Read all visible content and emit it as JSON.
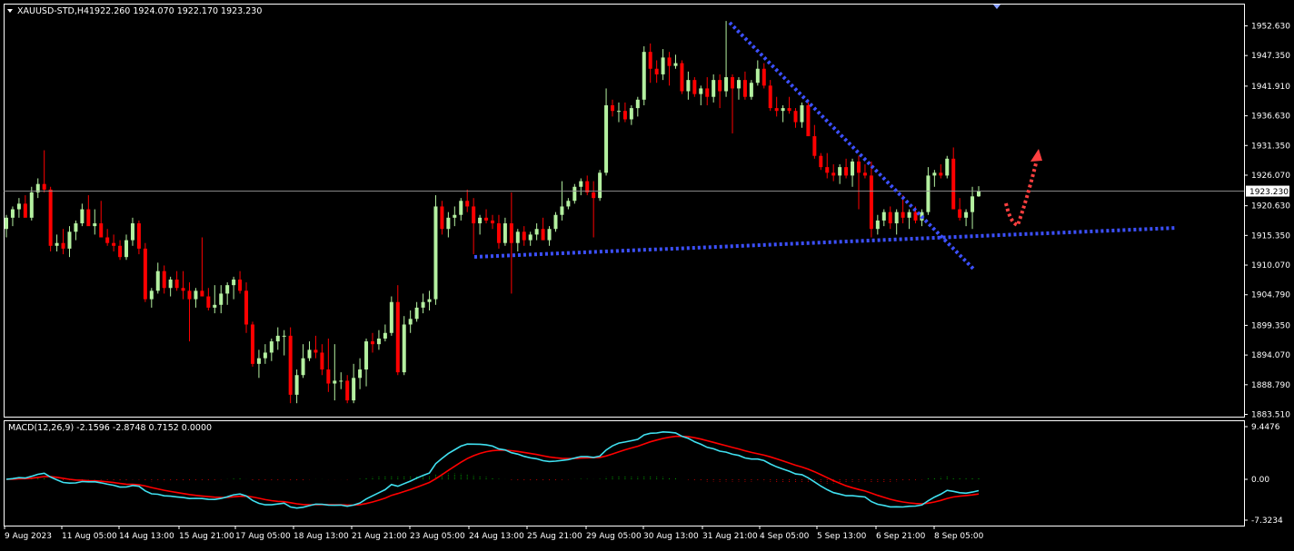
{
  "header": {
    "symbol": "XAUUSD-STD,H4",
    "ohlc": "1922.260 1924.070 1922.170 1923.230"
  },
  "macd_header": "MACD(12,26,9) -2.1596 -2.8748 0.7152 0.0000",
  "price_label": "1923.230",
  "colors": {
    "background": "#000000",
    "bull": "#b4f0a0",
    "bear": "#ff0000",
    "macd_line": "#40e0f0",
    "signal_line": "#ff0000",
    "trendline": "#3c50ff",
    "arrow": "#ff4040",
    "border": "#ffffff",
    "histogram_positive": "#00a000",
    "histogram_negative": "#c00000"
  },
  "chart_data": [
    {
      "type": "candlestick",
      "title": "XAUUSD-STD,H4",
      "y_ticks": [
        "1952.630",
        "1947.350",
        "1941.910",
        "1936.630",
        "1931.350",
        "1926.070",
        "1920.630",
        "1915.350",
        "1910.070",
        "1904.790",
        "1899.350",
        "1894.070",
        "1888.790",
        "1883.510"
      ],
      "ylim": [
        1883.51,
        1955.0
      ],
      "x_ticks": [
        "9 Aug 2023",
        "11 Aug 05:00",
        "14 Aug 13:00",
        "15 Aug 21:00",
        "17 Aug 05:00",
        "18 Aug 13:00",
        "21 Aug 21:00",
        "23 Aug 05:00",
        "24 Aug 13:00",
        "25 Aug 21:00",
        "29 Aug 05:00",
        "30 Aug 13:00",
        "31 Aug 21:00",
        "4 Sep 05:00",
        "5 Sep 13:00",
        "6 Sep 21:00",
        "8 Sep 05:00"
      ],
      "current_price": 1923.23,
      "candles_ohlc": [
        [
          1916.5,
          1919,
          1915,
          1918.5
        ],
        [
          1918.5,
          1920.5,
          1917,
          1920
        ],
        [
          1920,
          1922,
          1918.5,
          1921
        ],
        [
          1921,
          1922.5,
          1919,
          1918.5
        ],
        [
          1918.5,
          1924,
          1918,
          1923
        ],
        [
          1923,
          1925.5,
          1922,
          1924.5
        ],
        [
          1924.5,
          1930.5,
          1923,
          1923.5
        ],
        [
          1923.5,
          1924,
          1912.5,
          1913.5
        ],
        [
          1913.5,
          1915.5,
          1912.5,
          1914
        ],
        [
          1914,
          1916.5,
          1912,
          1913
        ],
        [
          1913,
          1917,
          1911.5,
          1916
        ],
        [
          1916,
          1918,
          1914.5,
          1917.5
        ],
        [
          1917.5,
          1921,
          1917,
          1920
        ],
        [
          1920,
          1922.5,
          1918,
          1917
        ],
        [
          1917,
          1920,
          1915.5,
          1917.5
        ],
        [
          1917.5,
          1921.5,
          1916.5,
          1915
        ],
        [
          1915,
          1916.5,
          1913.5,
          1914
        ],
        [
          1914,
          1915.5,
          1912.5,
          1913.5
        ],
        [
          1913.5,
          1914.5,
          1911,
          1911.5
        ],
        [
          1911.5,
          1915.5,
          1911,
          1914.5
        ],
        [
          1914.5,
          1918.5,
          1913.5,
          1917.5
        ],
        [
          1917.5,
          1918,
          1912,
          1913
        ],
        [
          1913,
          1914,
          1903.5,
          1904
        ],
        [
          1904,
          1906,
          1902.5,
          1905.5
        ],
        [
          1905.5,
          1910.5,
          1905,
          1909
        ],
        [
          1909,
          1910,
          1905,
          1906
        ],
        [
          1906,
          1908,
          1904.5,
          1907.5
        ],
        [
          1907.5,
          1909,
          1905.5,
          1906
        ],
        [
          1906,
          1909,
          1904,
          1905.5
        ],
        [
          1905.5,
          1907,
          1896.5,
          1904
        ],
        [
          1904,
          1906,
          1902.5,
          1905.5
        ],
        [
          1905.5,
          1915,
          1904.5,
          1904.5
        ],
        [
          1904.5,
          1906,
          1902,
          1902.5
        ],
        [
          1902.5,
          1906.5,
          1901.5,
          1903
        ],
        [
          1903,
          1906.5,
          1901.5,
          1905
        ],
        [
          1905,
          1907,
          1903,
          1906.5
        ],
        [
          1906.5,
          1908,
          1904,
          1907.5
        ],
        [
          1907.5,
          1909,
          1905,
          1905.5
        ],
        [
          1905.5,
          1907,
          1898,
          1899.5
        ],
        [
          1899.5,
          1900,
          1892,
          1892.5
        ],
        [
          1892.5,
          1895,
          1890,
          1893.5
        ],
        [
          1893.5,
          1896,
          1892.5,
          1894.5
        ],
        [
          1894.5,
          1897,
          1893,
          1896.5
        ],
        [
          1896.5,
          1899,
          1895,
          1897.5
        ],
        [
          1897.5,
          1898.5,
          1894,
          1897.5
        ],
        [
          1897.5,
          1899,
          1885.5,
          1887
        ],
        [
          1887,
          1891.5,
          1885.5,
          1890.5
        ],
        [
          1890.5,
          1896,
          1890,
          1893.5
        ],
        [
          1893.5,
          1896.5,
          1893,
          1895
        ],
        [
          1895,
          1897.5,
          1893.5,
          1894.5
        ],
        [
          1894.5,
          1896,
          1890.5,
          1891.5
        ],
        [
          1891.5,
          1897,
          1887.5,
          1889
        ],
        [
          1889,
          1896,
          1886,
          1889.5
        ],
        [
          1889.5,
          1891,
          1888,
          1889.5
        ],
        [
          1889.5,
          1890.5,
          1885.5,
          1886
        ],
        [
          1886,
          1892.5,
          1885.5,
          1890
        ],
        [
          1890,
          1893.5,
          1888,
          1891.5
        ],
        [
          1891.5,
          1897,
          1888.5,
          1896.5
        ],
        [
          1896.5,
          1898,
          1894.5,
          1896
        ],
        [
          1896,
          1898.5,
          1895,
          1897
        ],
        [
          1897,
          1899.5,
          1896.5,
          1898
        ],
        [
          1898,
          1904.5,
          1897.5,
          1903.5
        ],
        [
          1903.5,
          1906.5,
          1890.5,
          1891
        ],
        [
          1891,
          1901,
          1890.5,
          1899.5
        ],
        [
          1899.5,
          1902,
          1898,
          1900.5
        ],
        [
          1900.5,
          1903.5,
          1900,
          1902.5
        ],
        [
          1902.5,
          1905,
          1901.5,
          1903.5
        ],
        [
          1903.5,
          1905.5,
          1902,
          1904
        ],
        [
          1904,
          1922.5,
          1903,
          1920.5
        ],
        [
          1920.5,
          1921.5,
          1915.5,
          1916.5
        ],
        [
          1916.5,
          1919.5,
          1915,
          1918.5
        ],
        [
          1918.5,
          1920.5,
          1917,
          1919
        ],
        [
          1919,
          1922,
          1918,
          1921.5
        ],
        [
          1921.5,
          1923.5,
          1919.5,
          1920.5
        ],
        [
          1920.5,
          1922,
          1912,
          1917.5
        ],
        [
          1917.5,
          1919,
          1915.5,
          1918.5
        ],
        [
          1918.5,
          1920,
          1917.5,
          1918
        ],
        [
          1918,
          1919,
          1916.5,
          1917.5
        ],
        [
          1917.5,
          1919,
          1913,
          1914
        ],
        [
          1914,
          1918.5,
          1913.5,
          1917.5
        ],
        [
          1917.5,
          1923,
          1905,
          1914
        ],
        [
          1914,
          1916.5,
          1912.5,
          1916
        ],
        [
          1916,
          1917,
          1913.5,
          1914.5
        ],
        [
          1914.5,
          1916,
          1913.5,
          1915.5
        ],
        [
          1915.5,
          1917.5,
          1914.5,
          1916.5
        ],
        [
          1916.5,
          1918.5,
          1915.5,
          1914.5
        ],
        [
          1914.5,
          1917,
          1913.5,
          1916.5
        ],
        [
          1916.5,
          1919.5,
          1916,
          1919
        ],
        [
          1919,
          1925,
          1918,
          1920.5
        ],
        [
          1920.5,
          1922,
          1920,
          1921.5
        ],
        [
          1921.5,
          1924.5,
          1921,
          1924
        ],
        [
          1924,
          1925.5,
          1922.5,
          1925
        ],
        [
          1925,
          1926,
          1922.5,
          1923
        ],
        [
          1923,
          1925,
          1915,
          1922
        ],
        [
          1922,
          1927,
          1921.5,
          1926.5
        ],
        [
          1926.5,
          1941.5,
          1926,
          1938.5
        ],
        [
          1938.5,
          1939.5,
          1936.5,
          1937.5
        ],
        [
          1937.5,
          1939,
          1935.5,
          1937.5
        ],
        [
          1937.5,
          1939,
          1935.5,
          1936
        ],
        [
          1936,
          1938.5,
          1935,
          1938
        ],
        [
          1938,
          1940,
          1936.5,
          1939.5
        ],
        [
          1939.5,
          1949,
          1938.5,
          1948
        ],
        [
          1948,
          1949.5,
          1942.5,
          1945
        ],
        [
          1945,
          1946.5,
          1942.5,
          1944
        ],
        [
          1944,
          1948.5,
          1943,
          1947
        ],
        [
          1947,
          1948,
          1942,
          1945.5
        ],
        [
          1945.5,
          1947.5,
          1945,
          1946
        ],
        [
          1946,
          1946.5,
          1940.5,
          1941
        ],
        [
          1941,
          1944.5,
          1939.5,
          1943
        ],
        [
          1943,
          1943.5,
          1940,
          1940.5
        ],
        [
          1940.5,
          1942,
          1938.5,
          1941.5
        ],
        [
          1941.5,
          1943.5,
          1938.5,
          1940
        ],
        [
          1940,
          1944,
          1939,
          1943
        ],
        [
          1943,
          1944,
          1938,
          1941
        ],
        [
          1941,
          1953.5,
          1940,
          1943.5
        ],
        [
          1943.5,
          1944,
          1933.5,
          1941.5
        ],
        [
          1941.5,
          1943.5,
          1939.5,
          1943
        ],
        [
          1943,
          1944.5,
          1939.5,
          1940
        ],
        [
          1940,
          1943,
          1939.5,
          1942.5
        ],
        [
          1942.5,
          1946.5,
          1942,
          1945
        ],
        [
          1945,
          1946,
          1941.5,
          1942
        ],
        [
          1942,
          1943,
          1937.5,
          1938
        ],
        [
          1938,
          1940,
          1936.5,
          1937.5
        ],
        [
          1937.5,
          1938.5,
          1935.5,
          1938
        ],
        [
          1938,
          1940,
          1937,
          1937.5
        ],
        [
          1937.5,
          1938,
          1934.5,
          1935.5
        ],
        [
          1935.5,
          1939,
          1934.5,
          1938.5
        ],
        [
          1938.5,
          1939,
          1933,
          1933
        ],
        [
          1933,
          1935,
          1929,
          1929.5
        ],
        [
          1929.5,
          1930,
          1927,
          1927.5
        ],
        [
          1927.5,
          1930,
          1925.5,
          1926.5
        ],
        [
          1926.5,
          1928,
          1925,
          1926
        ],
        [
          1926,
          1928,
          1924.5,
          1927.5
        ],
        [
          1927.5,
          1929,
          1925.5,
          1926
        ],
        [
          1926,
          1929,
          1924,
          1928.5
        ],
        [
          1928.5,
          1929.5,
          1920,
          1926.5
        ],
        [
          1926.5,
          1928,
          1925.5,
          1926
        ],
        [
          1926,
          1928.5,
          1915,
          1916.5
        ],
        [
          1916.5,
          1919,
          1915.5,
          1918
        ],
        [
          1918,
          1920,
          1917,
          1919.5
        ],
        [
          1919.5,
          1920.5,
          1916.5,
          1917.5
        ],
        [
          1917.5,
          1920,
          1915.5,
          1919.5
        ],
        [
          1919.5,
          1922.5,
          1917.5,
          1918.5
        ],
        [
          1918.5,
          1920,
          1916.5,
          1919.5
        ],
        [
          1919.5,
          1920.5,
          1917.5,
          1918
        ],
        [
          1918,
          1920,
          1917,
          1919.5
        ],
        [
          1919.5,
          1927.5,
          1919,
          1926
        ],
        [
          1926,
          1927,
          1924,
          1926.5
        ],
        [
          1926.5,
          1928,
          1925.5,
          1926
        ],
        [
          1926,
          1929.5,
          1925.5,
          1929
        ],
        [
          1929,
          1931,
          1922,
          1920
        ],
        [
          1920,
          1922,
          1918,
          1918.5
        ],
        [
          1918.5,
          1920,
          1917,
          1919.5
        ],
        [
          1919.5,
          1924,
          1916.5,
          1922.3
        ],
        [
          1922.3,
          1924.1,
          1922.2,
          1923.23
        ]
      ]
    },
    {
      "type": "line",
      "title": "MACD(12,26,9)",
      "y_ticks": [
        "9.4476",
        "0.00",
        "-7.3234"
      ],
      "ylim": [
        -7.3234,
        9.4476
      ],
      "series": []
    }
  ]
}
